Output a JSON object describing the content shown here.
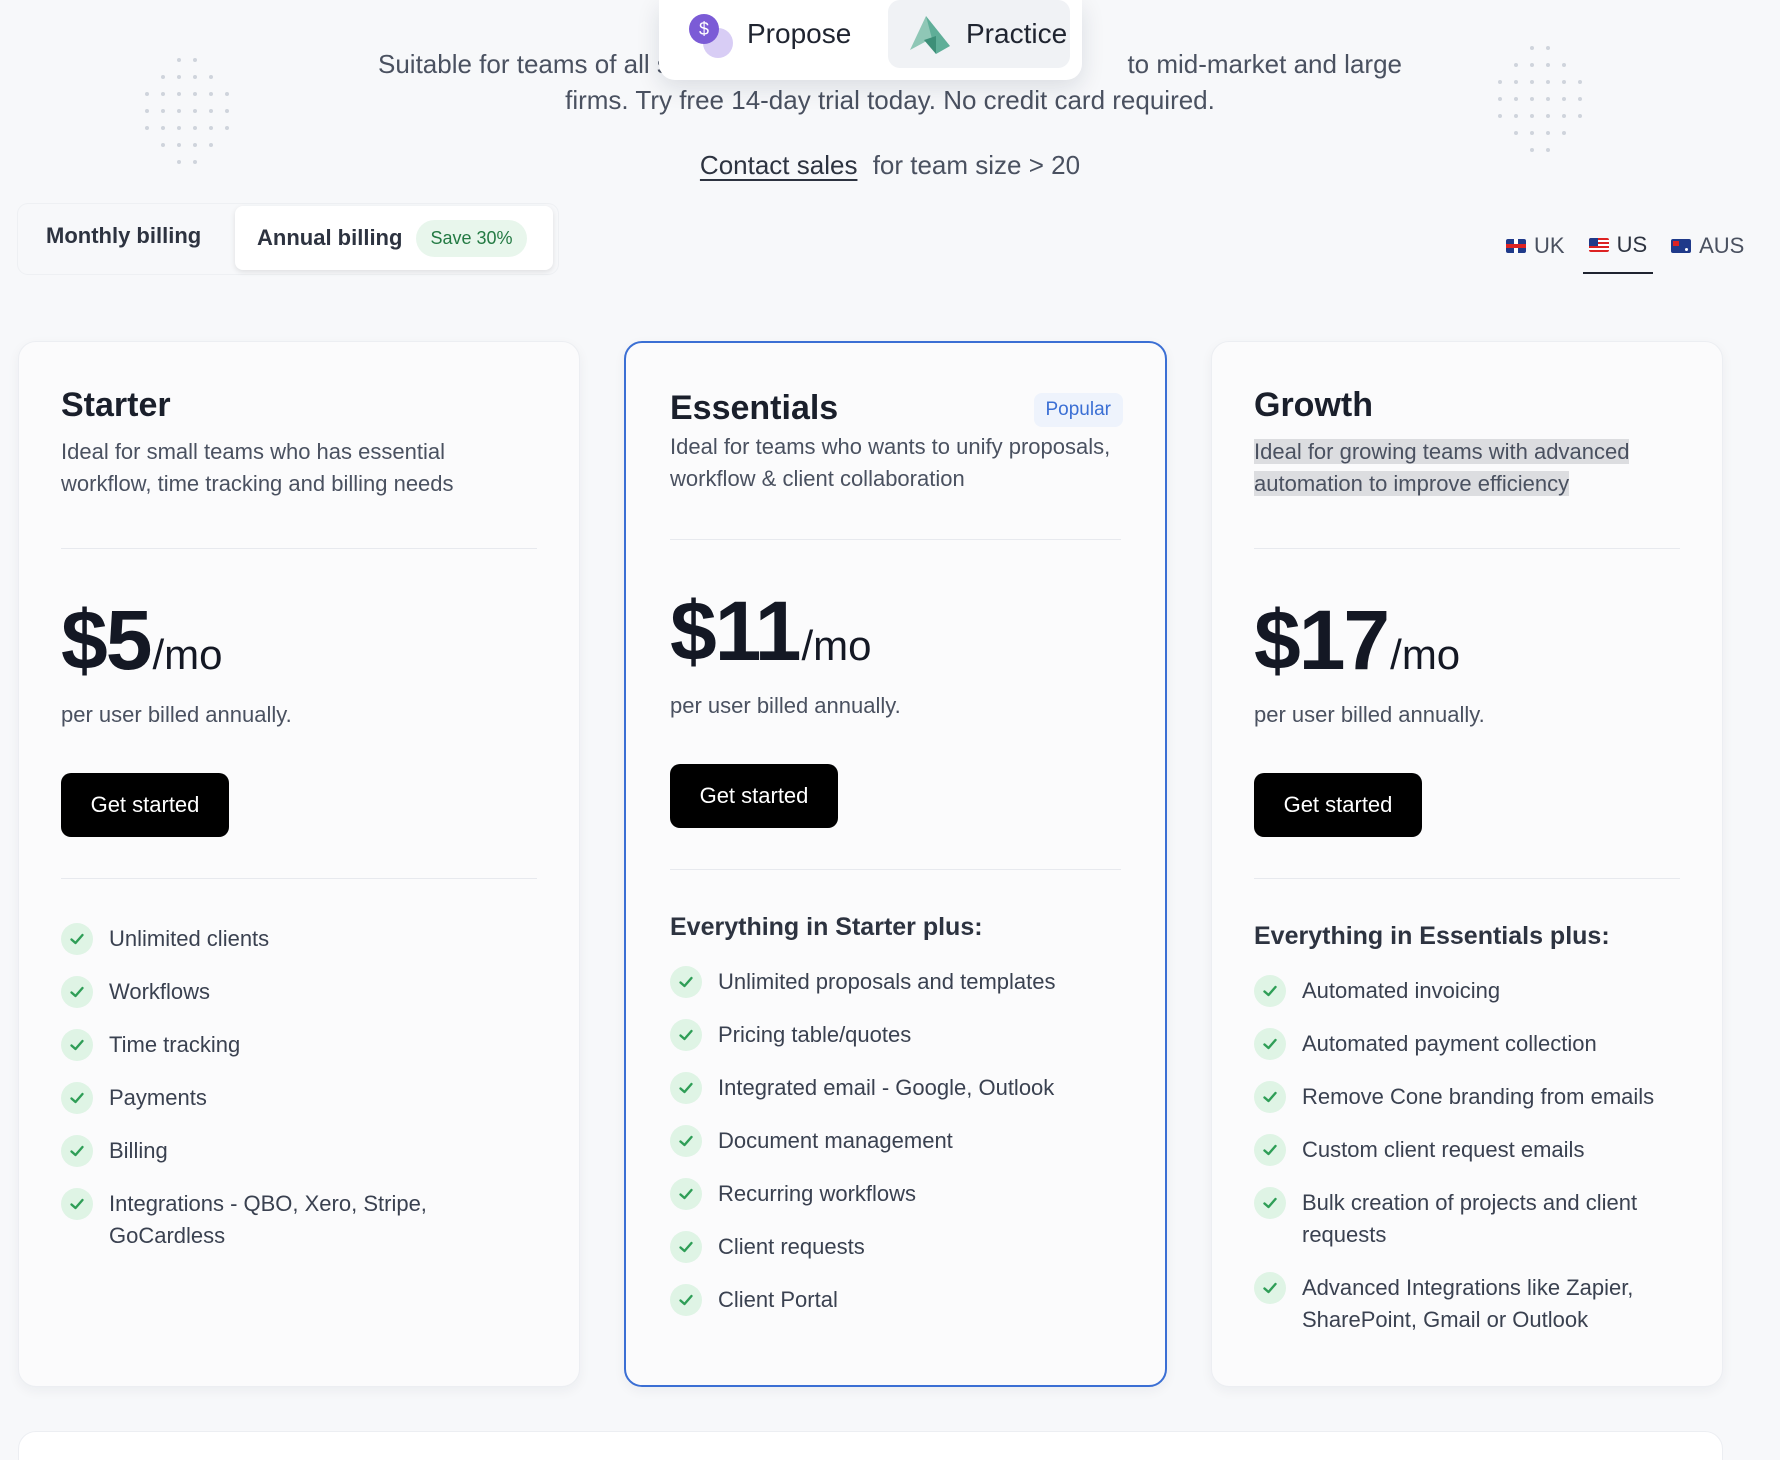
{
  "header": {
    "subtitle_line1": "Suitable for teams of all s",
    "subtitle_line1_end": "to mid-market and large",
    "subtitle_line2": "firms. Try free 14-day trial today. No credit card required.",
    "contact_link": "Contact sales",
    "contact_suffix": "for team size > 20"
  },
  "switcher": {
    "items": [
      {
        "label": "Propose",
        "icon": "propose-logo-icon"
      },
      {
        "label": "Practice",
        "icon": "practice-logo-icon"
      }
    ]
  },
  "billing": {
    "monthly_label": "Monthly billing",
    "annual_label": "Annual billing",
    "save_badge": "Save 30%",
    "selected": "annual"
  },
  "regions": {
    "items": [
      {
        "label": "UK",
        "icon": "uk-flag-icon"
      },
      {
        "label": "US",
        "icon": "us-flag-icon"
      },
      {
        "label": "AUS",
        "icon": "aus-flag-icon"
      }
    ],
    "selected": "US"
  },
  "plans": [
    {
      "name": "Starter",
      "description": "Ideal for small teams who has essential workflow, time tracking and billing needs",
      "price": "$5",
      "period": "/mo",
      "billed": "per user billed annually.",
      "cta": "Get started",
      "features": [
        "Unlimited clients",
        "Workflows",
        "Time tracking",
        "Payments",
        "Billing",
        "Integrations - QBO, Xero, Stripe, GoCardless"
      ]
    },
    {
      "name": "Essentials",
      "badge": "Popular",
      "description": "Ideal for teams who wants to unify proposals, workflow & client collaboration",
      "price": "$11",
      "period": "/mo",
      "billed": "per user billed annually.",
      "cta": "Get started",
      "features_heading": "Everything in Starter plus:",
      "features": [
        "Unlimited proposals and templates",
        "Pricing table/quotes",
        "Integrated email - Google, Outlook",
        "Document management",
        "Recurring workflows",
        "Client requests",
        "Client Portal"
      ]
    },
    {
      "name": "Growth",
      "description": "Ideal for growing teams with advanced automation to improve efficiency",
      "price": "$17",
      "period": "/mo",
      "billed": "per user billed annually.",
      "cta": "Get started",
      "features_heading": "Everything in Essentials plus:",
      "features": [
        "Automated invoicing",
        "Automated payment collection",
        "Remove Cone branding from emails",
        "Custom client request emails",
        "Bulk creation of projects and client requests",
        "Advanced Integrations like Zapier, SharePoint, Gmail or Outlook"
      ]
    }
  ],
  "colors": {
    "accent_border": "#3b6fd4",
    "check_bg": "#dff4e5",
    "check_mark": "#2f9e57",
    "save_badge_text": "#237a43",
    "cta_bg": "#000000"
  }
}
